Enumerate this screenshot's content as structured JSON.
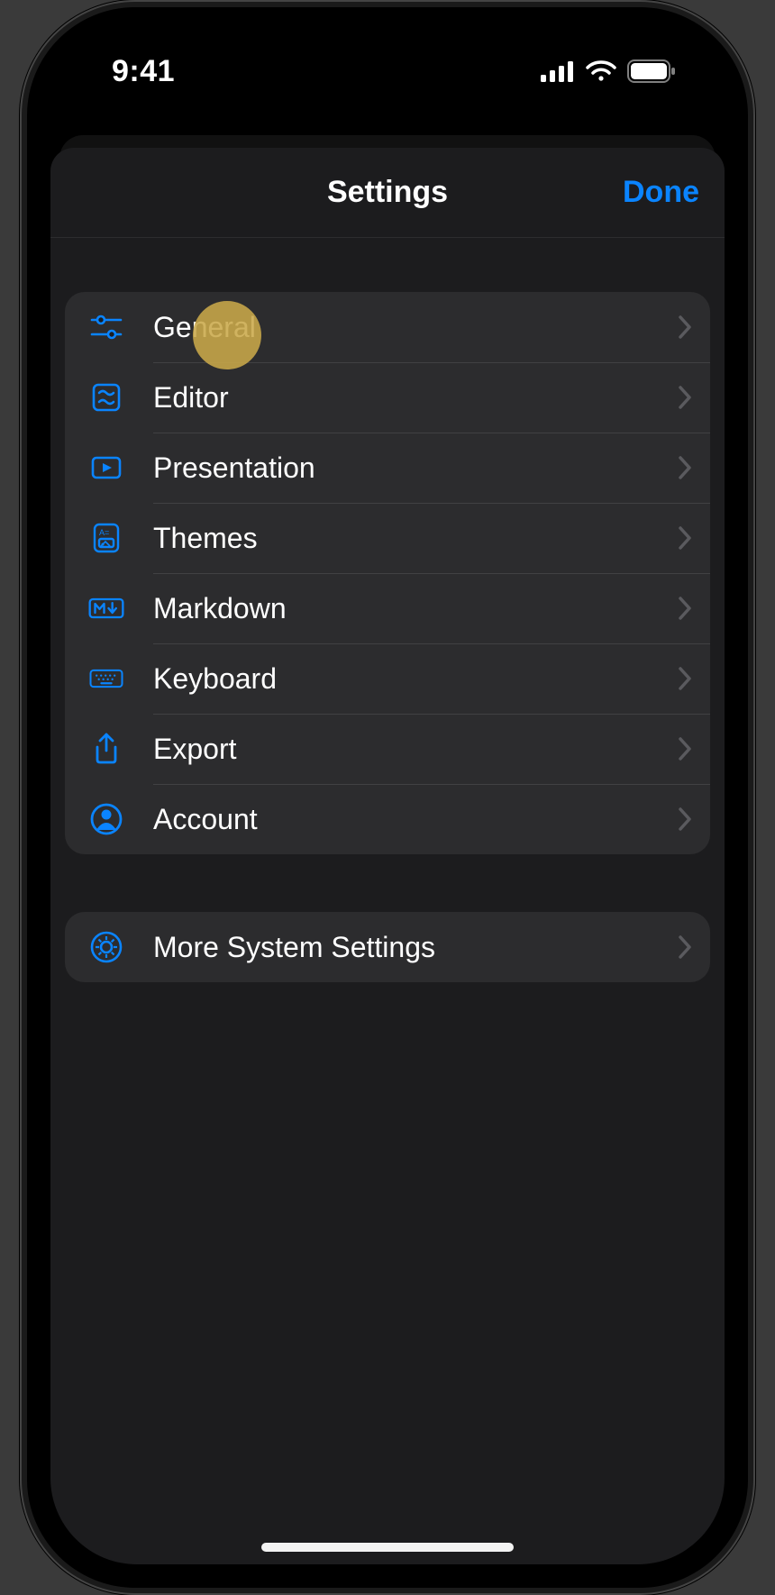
{
  "statusbar": {
    "time": "9:41"
  },
  "sheet": {
    "title": "Settings",
    "done_label": "Done"
  },
  "group1": {
    "items": [
      {
        "icon": "sliders",
        "label": "General"
      },
      {
        "icon": "editor",
        "label": "Editor"
      },
      {
        "icon": "presentation",
        "label": "Presentation"
      },
      {
        "icon": "themes",
        "label": "Themes"
      },
      {
        "icon": "markdown",
        "label": "Markdown"
      },
      {
        "icon": "keyboard",
        "label": "Keyboard"
      },
      {
        "icon": "export",
        "label": "Export"
      },
      {
        "icon": "account",
        "label": "Account"
      }
    ]
  },
  "group2": {
    "items": [
      {
        "icon": "gear",
        "label": "More System Settings"
      }
    ]
  },
  "colors": {
    "accent": "#0a84ff",
    "rowbg": "#2c2c2e",
    "sheetbg": "#1c1c1e",
    "tap_indicator": "#c9a94a"
  }
}
